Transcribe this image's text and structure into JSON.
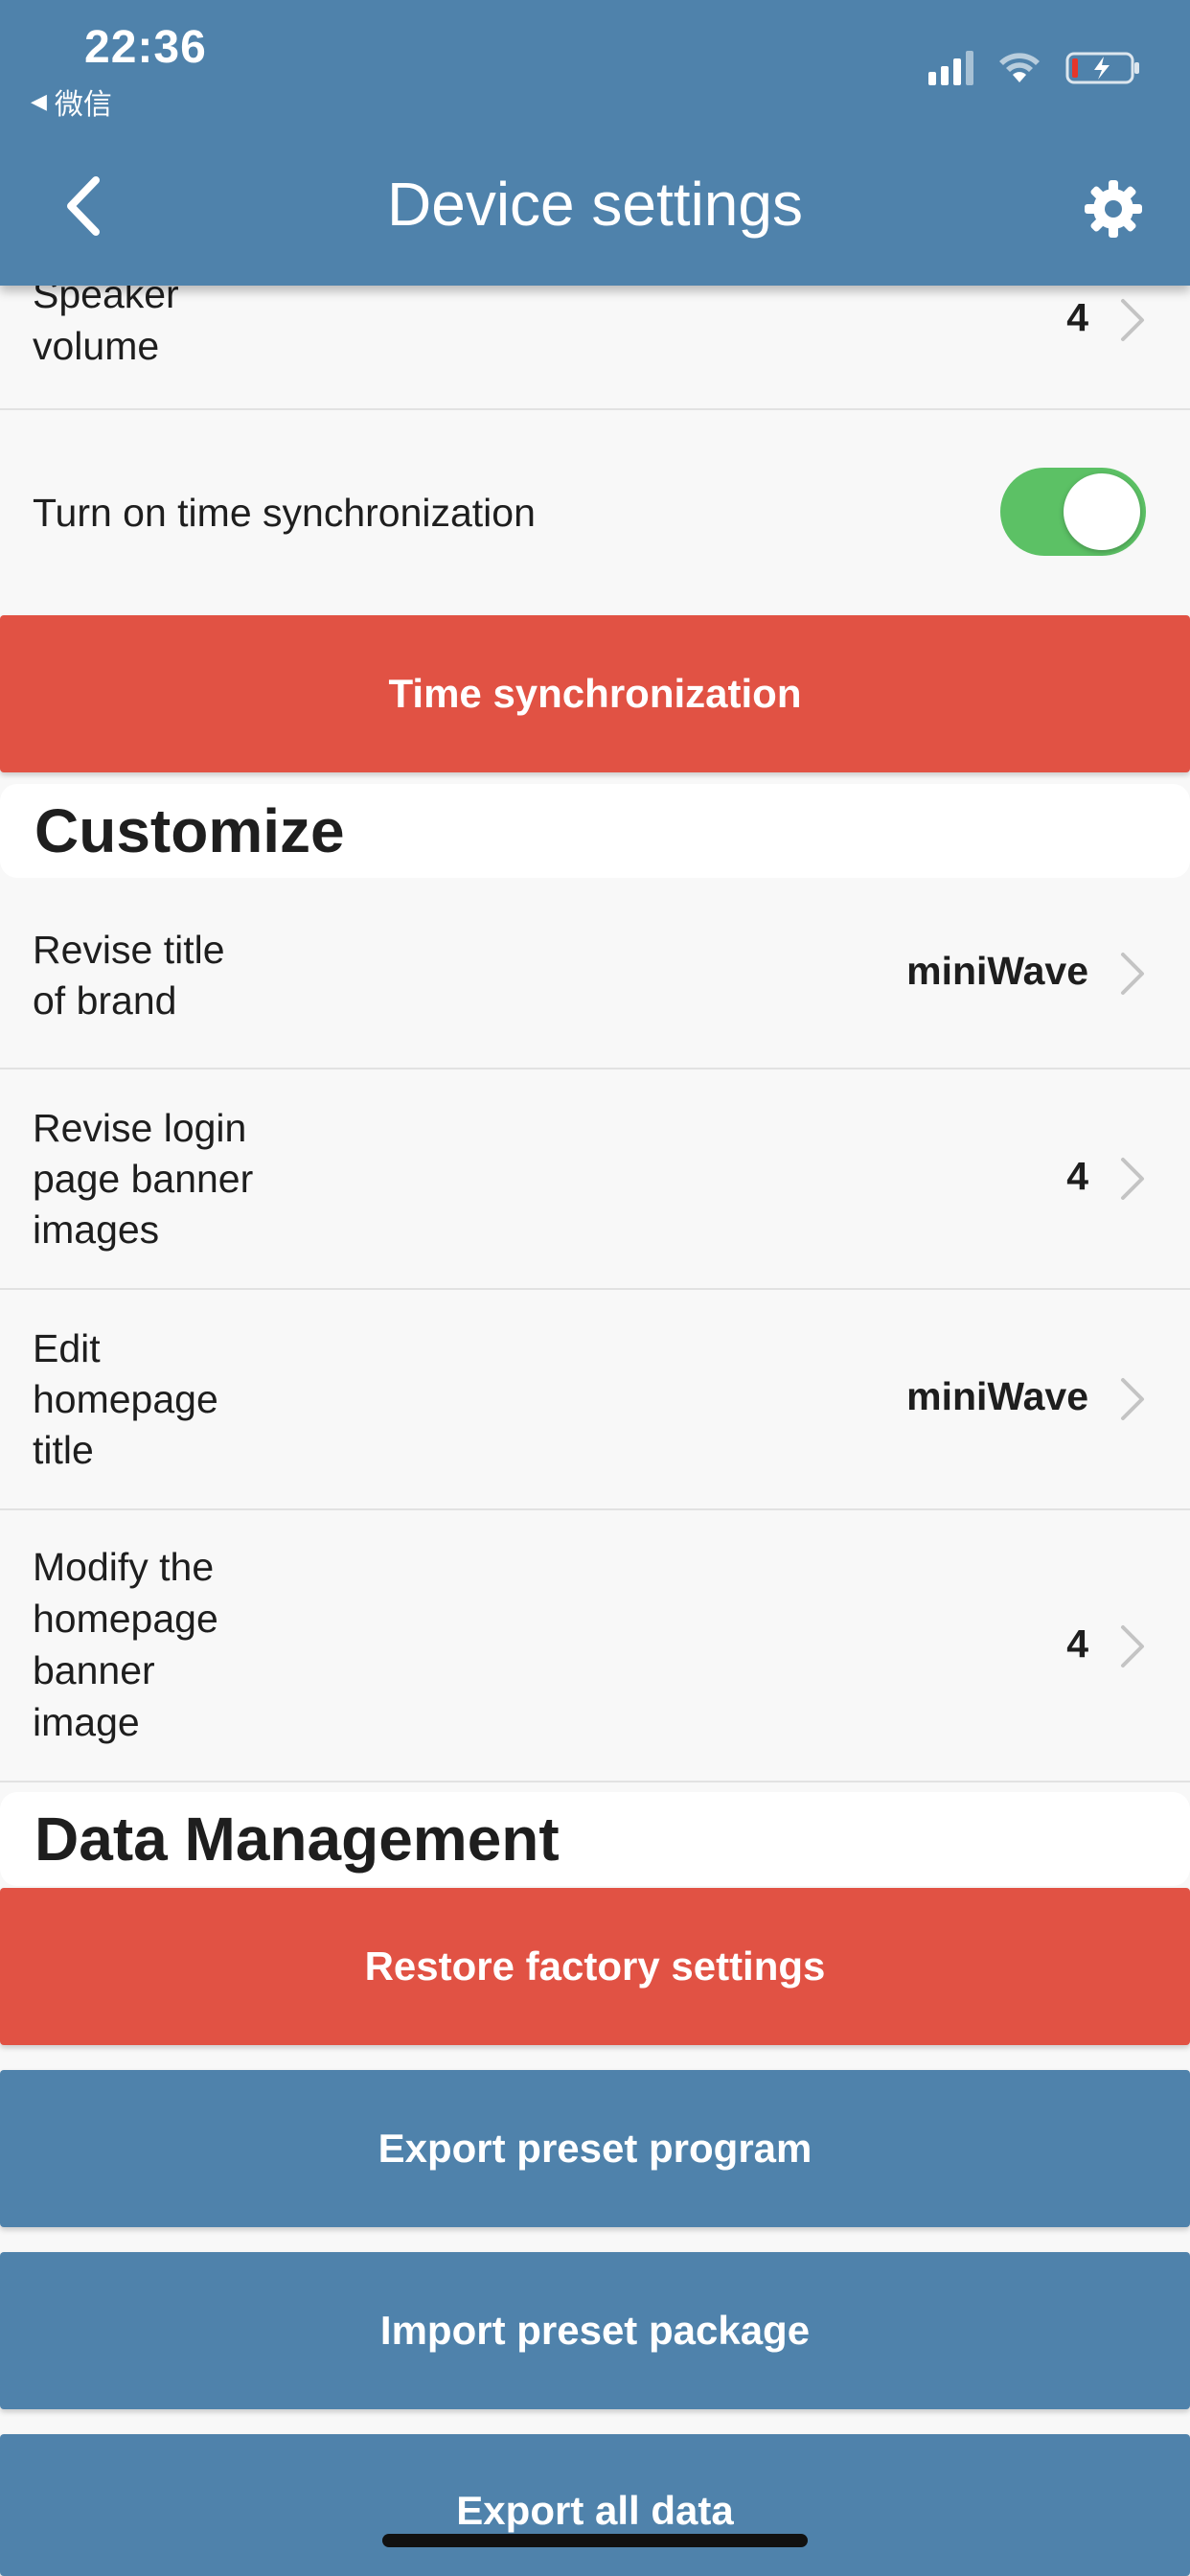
{
  "status_bar": {
    "time": "22:36",
    "back_app": "微信"
  },
  "header": {
    "title": "Device settings",
    "back_icon": "chevron-left-icon",
    "settings_icon": "gear-icon"
  },
  "settings": {
    "speaker_volume": {
      "label_line1": "Speaker",
      "label_line2": "volume",
      "value": "4"
    },
    "time_sync_toggle": {
      "label": "Turn on time synchronization",
      "on": true
    }
  },
  "buttons": {
    "time_sync": "Time synchronization",
    "restore": "Restore factory settings",
    "export_preset": "Export preset program",
    "import_preset": "Import preset package",
    "export_all": "Export all data"
  },
  "sections": {
    "customize": "Customize",
    "data_management": "Data Management"
  },
  "customize_rows": [
    {
      "lines": [
        "Revise title",
        "of brand"
      ],
      "value": "miniWave"
    },
    {
      "lines": [
        "Revise login",
        "page banner",
        "images"
      ],
      "value": "4"
    },
    {
      "lines": [
        "Edit",
        "homepage",
        "title"
      ],
      "value": "miniWave"
    },
    {
      "lines": [
        "Modify the",
        "homepage",
        "banner",
        "image"
      ],
      "value": "4"
    }
  ],
  "colors": {
    "header": "#4f82ab",
    "danger": "#e15244",
    "primary": "#4f82ab",
    "toggle_on": "#5cc165"
  }
}
